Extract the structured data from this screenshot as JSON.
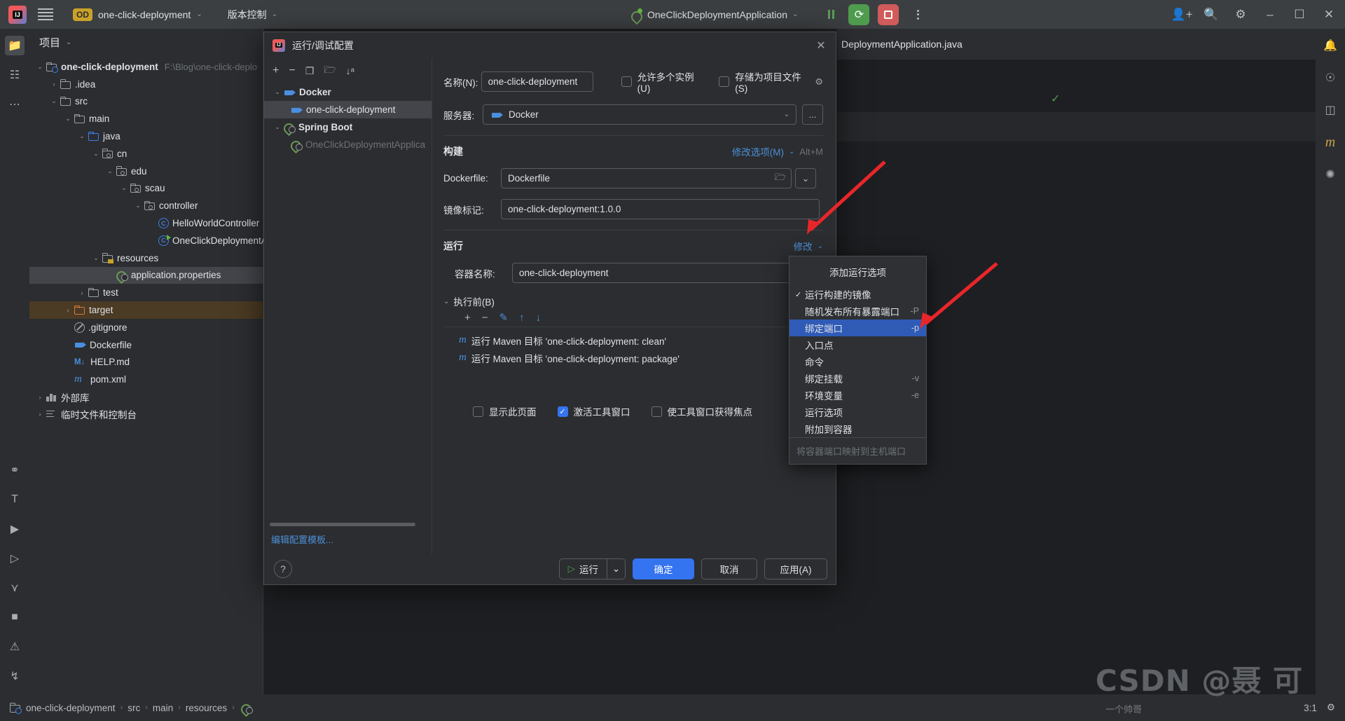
{
  "titlebar": {
    "logo_icon": "intellij-idea-logo",
    "logo_text": "IJ",
    "menu_icon": "hamburger-menu-icon",
    "project_badge": "OD",
    "project_name": "one-click-deployment",
    "vcs_label": "版本控制",
    "run_config_name": "OneClickDeploymentApplication",
    "pause_icon": "pause-icon",
    "rerun_icon": "rerun-with-settings-icon",
    "stop_icon": "stop-icon",
    "more_icon": "more-vertical-icon",
    "add_user_icon": "add-user-icon",
    "search_icon": "search-icon",
    "settings_icon": "gear-icon",
    "minimize_icon": "minimize-icon",
    "maximize_icon": "maximize-icon",
    "close_icon": "close-icon"
  },
  "rail_left": [
    {
      "icon": "project-folder-icon",
      "active": true
    },
    {
      "icon": "structure-icon",
      "active": false
    },
    {
      "icon": "more-tools-icon",
      "active": false
    },
    {
      "icon": "version-control-icon",
      "active": false
    },
    {
      "icon": "terminal-t-icon",
      "active": false
    },
    {
      "icon": "services-icon",
      "active": false
    },
    {
      "icon": "run-icon",
      "active": false
    },
    {
      "icon": "git-branch-icon",
      "active": false
    },
    {
      "icon": "terminal-icon",
      "active": false
    },
    {
      "icon": "problems-icon",
      "active": false
    },
    {
      "icon": "git-history-icon",
      "active": false
    }
  ],
  "rail_right": [
    {
      "icon": "notifications-bell-icon"
    },
    {
      "icon": "ai-assistant-icon"
    },
    {
      "icon": "database-icon"
    },
    {
      "icon": "maven-icon"
    },
    {
      "icon": "plugins-icon"
    }
  ],
  "project_panel": {
    "title": "项目",
    "chevron_icon": "chevron-down-icon",
    "tree": [
      {
        "label": "one-click-deployment",
        "sub": "F:\\Blog\\one-click-deplo",
        "indent": 0,
        "arrow": "down",
        "icon": "module-folder-icon",
        "bold": true
      },
      {
        "label": ".idea",
        "indent": 1,
        "arrow": "right",
        "icon": "folder-icon"
      },
      {
        "label": "src",
        "indent": 1,
        "arrow": "down",
        "icon": "folder-icon"
      },
      {
        "label": "main",
        "indent": 2,
        "arrow": "down",
        "icon": "folder-icon"
      },
      {
        "label": "java",
        "indent": 3,
        "arrow": "down",
        "icon": "source-root-folder-icon"
      },
      {
        "label": "cn",
        "indent": 4,
        "arrow": "down",
        "icon": "package-icon"
      },
      {
        "label": "edu",
        "indent": 5,
        "arrow": "down",
        "icon": "package-icon"
      },
      {
        "label": "scau",
        "indent": 6,
        "arrow": "down",
        "icon": "package-icon"
      },
      {
        "label": "controller",
        "indent": 7,
        "arrow": "down",
        "icon": "package-icon"
      },
      {
        "label": "HelloWorldController",
        "indent": 8,
        "arrow": "none",
        "icon": "java-class-icon"
      },
      {
        "label": "OneClickDeploymentAp",
        "indent": 8,
        "arrow": "none",
        "icon": "java-runnable-class-icon"
      },
      {
        "label": "resources",
        "indent": 4,
        "arrow": "down",
        "icon": "resources-folder-icon"
      },
      {
        "label": "application.properties",
        "indent": 5,
        "arrow": "none",
        "icon": "spring-properties-icon",
        "state": "selected"
      },
      {
        "label": "test",
        "indent": 3,
        "arrow": "right",
        "icon": "folder-icon"
      },
      {
        "label": "target",
        "indent": 2,
        "arrow": "right",
        "icon": "excluded-folder-icon",
        "state": "highlighted"
      },
      {
        "label": ".gitignore",
        "indent": 2,
        "arrow": "none",
        "icon": "gitignore-icon"
      },
      {
        "label": "Dockerfile",
        "indent": 2,
        "arrow": "none",
        "icon": "docker-icon"
      },
      {
        "label": "HELP.md",
        "indent": 2,
        "arrow": "none",
        "icon": "markdown-icon"
      },
      {
        "label": "pom.xml",
        "indent": 2,
        "arrow": "none",
        "icon": "maven-pom-icon"
      },
      {
        "label": "外部库",
        "indent": 0,
        "arrow": "right",
        "icon": "external-libraries-icon"
      },
      {
        "label": "临时文件和控制台",
        "indent": 0,
        "arrow": "right",
        "icon": "scratches-consoles-icon"
      }
    ]
  },
  "editor": {
    "tab_name": "DeploymentApplication.java",
    "kebab_icon": "more-vertical-icon",
    "check_icon": "inspections-ok-icon"
  },
  "dialog": {
    "title": "运行/调试配置",
    "icon": "intellij-idea-logo",
    "close_icon": "close-icon",
    "toolbar": [
      {
        "icon": "add-icon",
        "glyph": "+"
      },
      {
        "icon": "remove-icon",
        "glyph": "−"
      },
      {
        "icon": "copy-configuration-icon",
        "glyph": "❐"
      },
      {
        "icon": "new-folder-icon",
        "glyph": "🗀"
      },
      {
        "icon": "sort-alphabetically-icon",
        "glyph": "↓"
      }
    ],
    "config_tree": [
      {
        "label": "Docker",
        "icon": "docker-icon",
        "type": "group",
        "arrow": "down"
      },
      {
        "label": "one-click-deployment",
        "icon": "docker-icon",
        "type": "item",
        "state": "selected"
      },
      {
        "label": "Spring Boot",
        "icon": "spring-icon",
        "type": "group",
        "arrow": "down"
      },
      {
        "label": "OneClickDeploymentApplica",
        "icon": "spring-icon",
        "type": "item",
        "state": "dim"
      }
    ],
    "edit_templates_link": "编辑配置模板...",
    "form": {
      "name_label": "名称(N):",
      "name_value": "one-click-deployment",
      "allow_multiple_label": "允许多个实例(U)",
      "allow_multiple_checked": false,
      "store_as_project_label": "存储为项目文件(S)",
      "store_as_project_checked": false,
      "store_gear_icon": "gear-icon",
      "server_label": "服务器:",
      "server_value": "Docker",
      "server_icon": "docker-icon",
      "server_browse": "...",
      "build_section": "构建",
      "modify_options_link": "修改选项(M)",
      "modify_options_shortcut": "Alt+M",
      "dockerfile_label": "Dockerfile:",
      "dockerfile_value": "Dockerfile",
      "dockerfile_browse_icon": "folder-browse-icon",
      "dockerfile_history_icon": "chevron-down-icon",
      "image_tag_label": "镜像标记:",
      "image_tag_value": "one-click-deployment:1.0.0",
      "run_section": "运行",
      "modify_link": "修改",
      "container_name_label": "容器名称:",
      "container_name_value": "one-click-deployment",
      "before_launch_label": "执行前(B)",
      "before_launch_toolbar": [
        {
          "icon": "add-icon",
          "glyph": "+"
        },
        {
          "icon": "remove-icon",
          "glyph": "−"
        },
        {
          "icon": "edit-icon",
          "glyph": "✎"
        },
        {
          "icon": "move-up-icon",
          "glyph": "↑"
        },
        {
          "icon": "move-down-icon",
          "glyph": "↓"
        }
      ],
      "before_launch_items": [
        {
          "icon": "maven-icon",
          "label": "运行 Maven 目标 'one-click-deployment: clean'"
        },
        {
          "icon": "maven-icon",
          "label": "运行 Maven 目标 'one-click-deployment: package'"
        }
      ],
      "show_page_label": "显示此页面",
      "show_page_checked": false,
      "activate_tool_window_label": "激活工具窗口",
      "activate_tool_window_checked": true,
      "focus_tool_window_label": "使工具窗口获得焦点",
      "focus_tool_window_checked": false
    },
    "footer": {
      "help_icon": "help-icon",
      "run_label": "运行",
      "run_icon": "run-play-icon",
      "run_dropdown_icon": "chevron-down-icon",
      "ok_label": "确定",
      "cancel_label": "取消",
      "apply_label": "应用(A)"
    }
  },
  "popup_menu": {
    "title": "添加运行选项",
    "items": [
      {
        "label": "运行构建的镜像",
        "checked": true,
        "flag": "",
        "selected": false
      },
      {
        "label": "随机发布所有暴露端口",
        "checked": false,
        "flag": "-P",
        "selected": false
      },
      {
        "label": "绑定端口",
        "checked": false,
        "flag": "-p",
        "selected": true
      },
      {
        "label": "入口点",
        "checked": false,
        "flag": "",
        "selected": false
      },
      {
        "label": "命令",
        "checked": false,
        "flag": "",
        "selected": false
      },
      {
        "label": "绑定挂载",
        "checked": false,
        "flag": "-v",
        "selected": false
      },
      {
        "label": "环境变量",
        "checked": false,
        "flag": "-e",
        "selected": false
      },
      {
        "label": "运行选项",
        "checked": false,
        "flag": "",
        "selected": false
      },
      {
        "label": "附加到容器",
        "checked": false,
        "flag": "",
        "selected": false
      }
    ],
    "footer_hint": "将容器端口映射到主机端口"
  },
  "status_bar": {
    "breadcrumbs": [
      "one-click-deployment",
      "src",
      "main",
      "resources"
    ],
    "breadcrumb_icon": "spring-properties-icon",
    "caret_position": "3:1"
  },
  "watermark": {
    "text": "CSDN @聂 可",
    "sub": "一个帅哥"
  },
  "colors": {
    "accent_blue": "#3574f0",
    "link_blue": "#4d8fd6",
    "selection_blue": "#2f5bb7",
    "docker_blue": "#4a8fe0",
    "spring_green": "#62b543",
    "run_green": "#4f9c4f",
    "stop_red": "#d15b5b",
    "annotation_red": "#e8262a",
    "bg_dark": "#2b2d30",
    "bg_editor": "#1e1f22",
    "highlight_brown": "#4b3a24"
  }
}
